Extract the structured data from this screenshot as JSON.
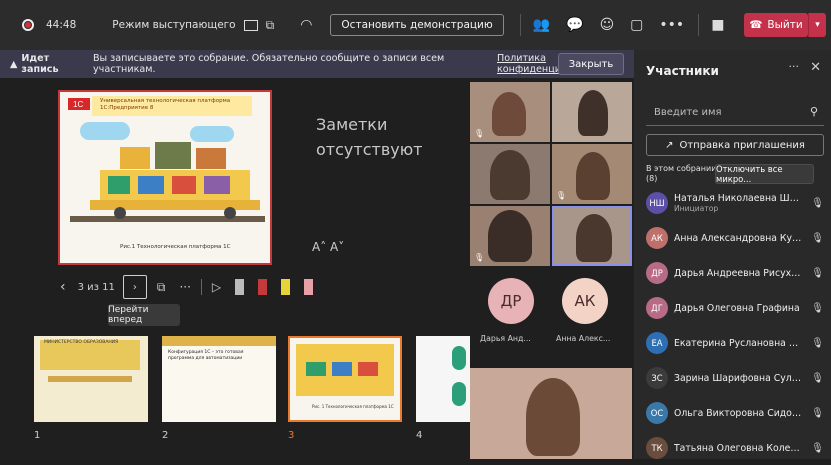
{
  "topbar": {
    "timer": "44:48",
    "mode_label": "Режим выступающего",
    "stop_demo_label": "Остановить демонстрацию",
    "leave_label": "Выйти"
  },
  "banner": {
    "bold": "Идет запись",
    "text": "Вы записываете это собрание. Обязательно сообщите о записи всем участникам.",
    "link": "Политика конфиденциаль...",
    "close_label": "Закрыть"
  },
  "stage": {
    "slide_title": "Универсальная технологическая платформа 1С:Предприятие 8",
    "slide_caption": "Рис.1 Технологическая платформа 1С",
    "notes_line1": "Заметки",
    "notes_line2": "отсутствуют",
    "font_buttons": "A˄  A˅",
    "page_counter": "3 из 11",
    "tooltip": "Перейти вперед",
    "thumb_numbers": [
      "1",
      "2",
      "3",
      "4"
    ],
    "thumb1_text": "МИНИСТЕРСТВО ОБРАЗОВАНИЯ",
    "thumb2_text": "Конфигурация 1С – это готовая программа для автоматизации",
    "thumb3_caption": "Рис. 1 Технологическая платформа 1С"
  },
  "videos": {
    "avatar1_initials": "ДР",
    "avatar2_initials": "АК",
    "avatar1_label": "Дарья Анд...",
    "avatar2_label": "Анна Алекс..."
  },
  "panel": {
    "title": "Участники",
    "search_placeholder": "Введите имя",
    "invite_label": "Отправка приглашения",
    "in_meeting": "В этом собрании",
    "in_meeting_count": "(8)",
    "mute_all_label": "Отключить все микро...",
    "participants": [
      {
        "initials": "НШ",
        "name": "Наталья Николаевна Шабан...",
        "sub": "Инициатор",
        "color": "#5b4fa6"
      },
      {
        "initials": "АК",
        "name": "Анна Александровна Кусая",
        "sub": "",
        "color": "#c0706b"
      },
      {
        "initials": "ДР",
        "name": "Дарья Андреевна Рисухина",
        "sub": "",
        "color": "#b86b86"
      },
      {
        "initials": "ДГ",
        "name": "Дарья Олеговна Графина",
        "sub": "",
        "color": "#b86b86"
      },
      {
        "initials": "ЕА",
        "name": "Екатерина Руслановна Абро...",
        "sub": "",
        "color": "#2e6fb3"
      },
      {
        "initials": "ЗС",
        "name": "Зарина Шарифовна Сулейм...",
        "sub": "",
        "color": "#3b3b3b"
      },
      {
        "initials": "ОС",
        "name": "Ольга Викторовна Сидоренко",
        "sub": "",
        "color": "#3a78a8"
      },
      {
        "initials": "ТК",
        "name": "Татьяна Олеговна Колеганова",
        "sub": "",
        "color": "#6b4d3d"
      }
    ]
  }
}
